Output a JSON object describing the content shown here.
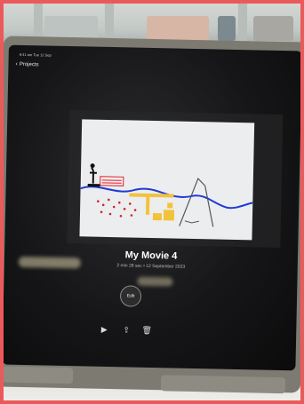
{
  "status_bar": {
    "time_date": "9:41 am  Tue 12 Sep"
  },
  "nav": {
    "back_label": "Projects"
  },
  "project": {
    "title": "My Movie 4",
    "meta": "2 min 28 sec • 12 September 2023",
    "edit_label": "Edit"
  },
  "toolbar": {
    "play_icon": "play-icon",
    "share_icon": "share-icon",
    "delete_icon": "trash-icon"
  },
  "colors": {
    "frame_border": "#ea5a5a",
    "screen_bg": "#161618",
    "title_text": "#ffffff",
    "drawing_blue": "#1f3bd6",
    "drawing_red": "#d3222f",
    "drawing_yellow": "#f2c23a"
  }
}
